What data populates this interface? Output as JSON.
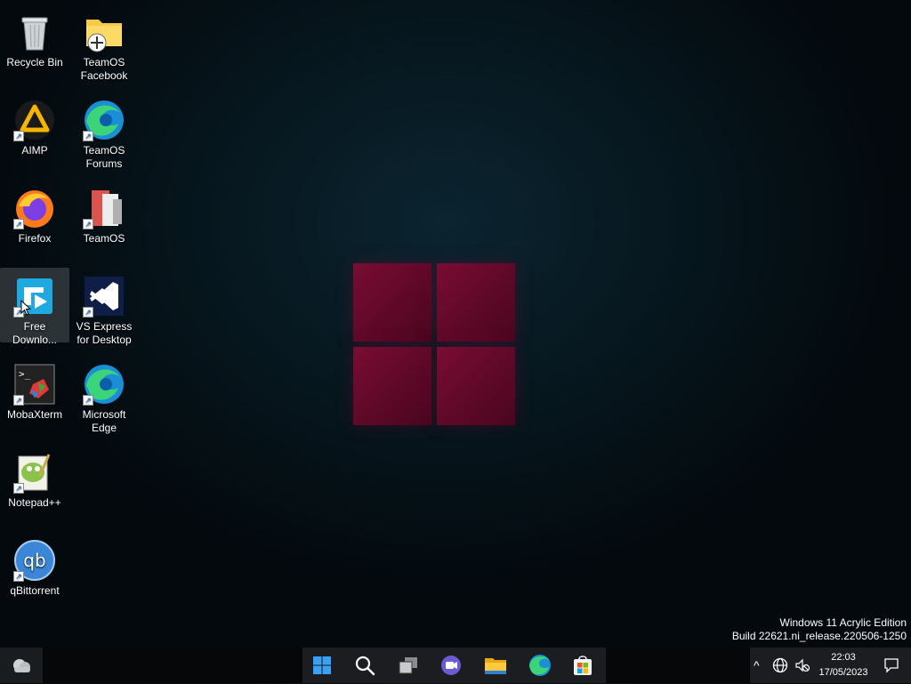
{
  "desktop": {
    "icons": [
      {
        "label": "Recycle Bin",
        "icon": "recycle-bin-icon"
      },
      {
        "label": "TeamOS Facebook",
        "icon": "folder-shortcut-icon"
      },
      {
        "label": "AIMP",
        "icon": "aimp-icon"
      },
      {
        "label": "TeamOS Forums",
        "icon": "edge-icon"
      },
      {
        "label": "Firefox",
        "icon": "firefox-icon"
      },
      {
        "label": "TeamOS",
        "icon": "teamos-icon"
      },
      {
        "label": "Free Downlo...",
        "icon": "free-download-manager-icon"
      },
      {
        "label": "VS Express for Desktop",
        "icon": "visual-studio-icon"
      },
      {
        "label": "MobaXterm",
        "icon": "mobaxterm-icon"
      },
      {
        "label": "Microsoft Edge",
        "icon": "edge-icon"
      },
      {
        "label": "Notepad++",
        "icon": "notepadpp-icon"
      },
      {
        "label": "qBittorrent",
        "icon": "qbittorrent-icon"
      }
    ],
    "watermark": {
      "line1": "Windows 11 Acrylic Edition",
      "line2": "Build 22621.ni_release.220506-1250"
    }
  },
  "taskbar": {
    "pinned": [
      "start-icon",
      "search-icon",
      "task-view-icon",
      "chat-icon",
      "file-explorer-icon",
      "edge-icon",
      "store-icon"
    ],
    "tray": {
      "chevron": "^",
      "time": "22:03",
      "date": "17/05/2023"
    }
  },
  "colors": {
    "accent": "#0078d4",
    "logo": "#6a0a2c"
  }
}
